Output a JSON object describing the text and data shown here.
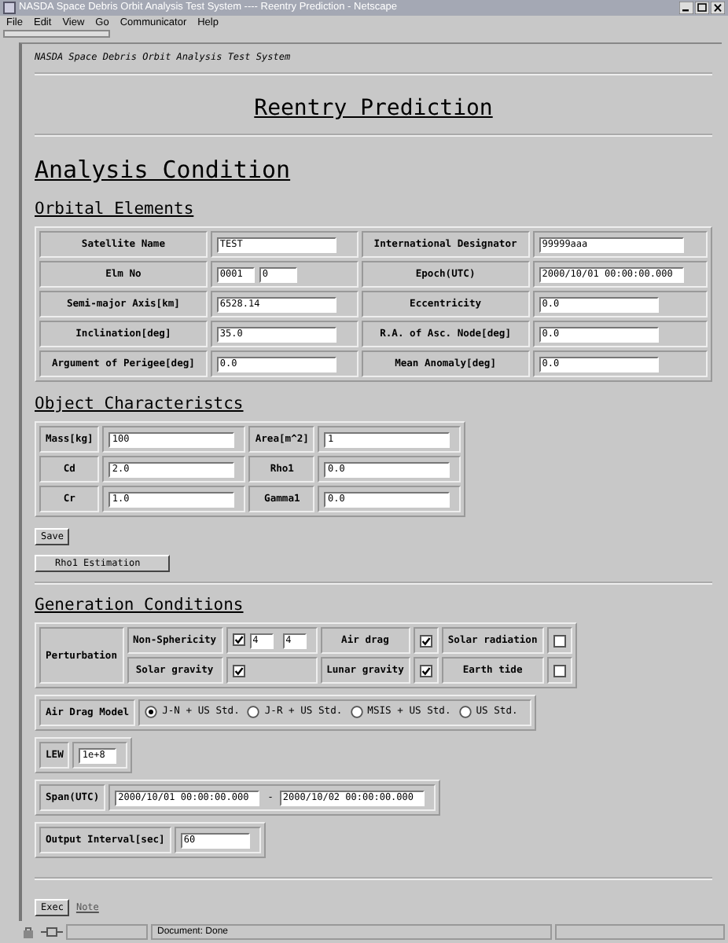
{
  "window": {
    "title": "NASDA Space Debris Orbit Analysis Test System ---- Reentry Prediction - Netscape"
  },
  "menu": [
    "File",
    "Edit",
    "View",
    "Go",
    "Communicator",
    "Help"
  ],
  "header": "NASDA Space Debris Orbit Analysis Test System",
  "page_title": "Reentry Prediction",
  "section_title": "Analysis Condition",
  "orbital_elements": {
    "heading": "Orbital Elements",
    "rows": [
      [
        {
          "label": "Satellite Name",
          "fields": [
            "TEST"
          ]
        },
        {
          "label": "International Designator",
          "fields": [
            "99999aaa"
          ]
        }
      ],
      [
        {
          "label": "Elm No",
          "fields": [
            "0001",
            "0"
          ]
        },
        {
          "label": "Epoch(UTC)",
          "fields": [
            "2000/10/01 00:00:00.000"
          ]
        }
      ],
      [
        {
          "label": "Semi-major Axis[km]",
          "fields": [
            "6528.14"
          ]
        },
        {
          "label": "Eccentricity",
          "fields": [
            "0.0"
          ]
        }
      ],
      [
        {
          "label": "Inclination[deg]",
          "fields": [
            "35.0"
          ]
        },
        {
          "label": "R.A. of Asc. Node[deg]",
          "fields": [
            "0.0"
          ]
        }
      ],
      [
        {
          "label": "Argument of Perigee[deg]",
          "fields": [
            "0.0"
          ]
        },
        {
          "label": "Mean Anomaly[deg]",
          "fields": [
            "0.0"
          ]
        }
      ]
    ]
  },
  "object_characteristics": {
    "heading": "Object Characteristcs",
    "rows": [
      [
        {
          "label": "Mass[kg]",
          "value": "100"
        },
        {
          "label": "Area[m^2]",
          "value": "1"
        }
      ],
      [
        {
          "label": "Cd",
          "value": "2.0"
        },
        {
          "label": "Rho1",
          "value": "0.0"
        }
      ],
      [
        {
          "label": "Cr",
          "value": "1.0"
        },
        {
          "label": "Gamma1",
          "value": "0.0"
        }
      ]
    ]
  },
  "save_button": "Save",
  "rho_button": "Rho1 Estimation",
  "generation_conditions": {
    "heading": "Generation Conditions",
    "perturbation": {
      "label": "Perturbation",
      "rows": [
        [
          {
            "label": "Non-Sphericity",
            "checked": true,
            "fields": [
              "4",
              "4"
            ]
          },
          {
            "label": "Air drag",
            "checked": true
          },
          {
            "label": "Solar radiation",
            "checked": false
          }
        ],
        [
          {
            "label": "Solar gravity",
            "checked": true
          },
          {
            "label": "Lunar gravity",
            "checked": true
          },
          {
            "label": "Earth tide",
            "checked": false
          }
        ]
      ]
    },
    "air_drag_model": {
      "label": "Air Drag Model",
      "options": [
        {
          "label": "J-N + US Std.",
          "selected": true
        },
        {
          "label": "J-R + US Std.",
          "selected": false
        },
        {
          "label": "MSIS + US Std.",
          "selected": false
        },
        {
          "label": "US Std.",
          "selected": false
        }
      ]
    },
    "lew": {
      "label": "LEW",
      "value": "1e+8"
    },
    "span": {
      "label": "Span(UTC)",
      "from": "2000/10/01 00:00:00.000",
      "separator": "-",
      "to": "2000/10/02 00:00:00.000"
    },
    "output_interval": {
      "label": "Output Interval[sec]",
      "value": "60"
    }
  },
  "exec_button": "Exec",
  "note_link": "Note",
  "status_bar": {
    "text": "Document: Done"
  }
}
